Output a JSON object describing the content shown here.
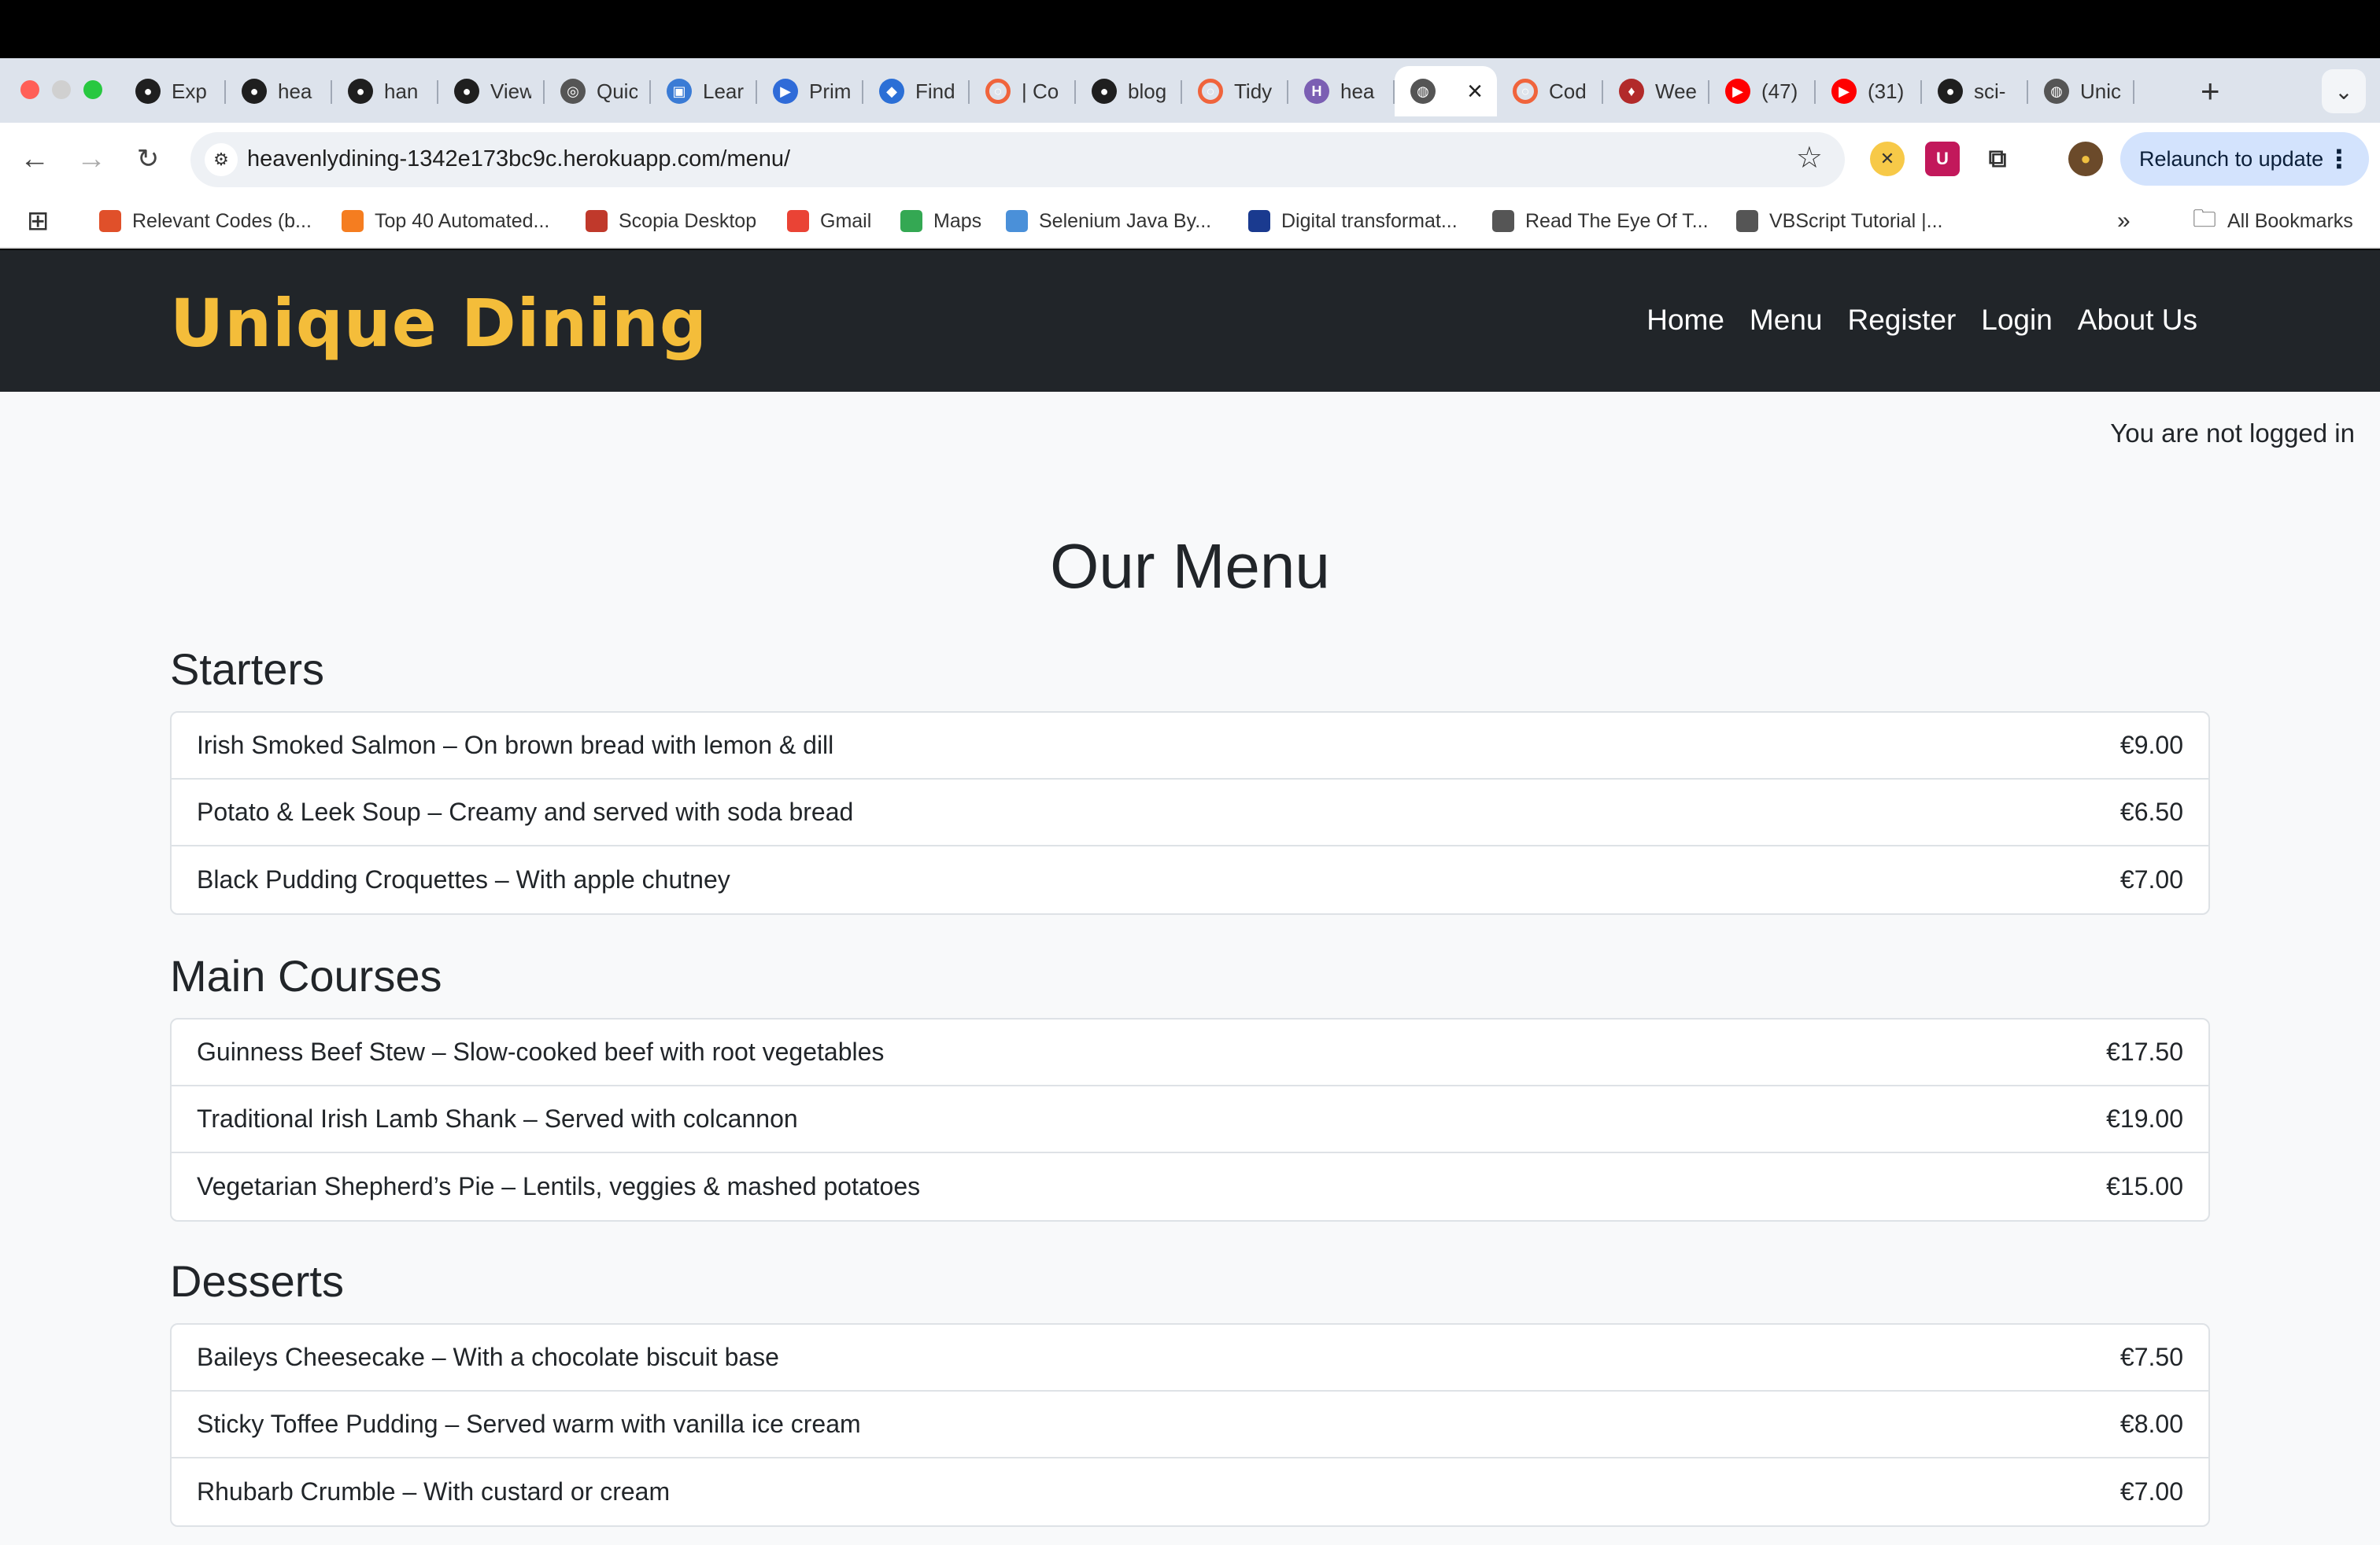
{
  "browser": {
    "tabs": [
      {
        "label": "Exp",
        "icon": "github-icon",
        "color": "#1f1f1f"
      },
      {
        "label": "hea",
        "icon": "github-icon",
        "color": "#1f1f1f"
      },
      {
        "label": "han",
        "icon": "github-icon",
        "color": "#1f1f1f"
      },
      {
        "label": "View",
        "icon": "github-icon",
        "color": "#1f1f1f"
      },
      {
        "label": "Quic",
        "icon": "quick-icon",
        "color": "#555555"
      },
      {
        "label": "Lear",
        "icon": "learn-icon",
        "color": "#3a7bd5"
      },
      {
        "label": "Prim",
        "icon": "play-icon",
        "color": "#2f6bd8"
      },
      {
        "label": "Find",
        "icon": "find-icon",
        "color": "#2b6fd6"
      },
      {
        "label": "| Co",
        "icon": "ring-icon",
        "color": "#f0643c"
      },
      {
        "label": "blog",
        "icon": "github-icon",
        "color": "#1f1f1f"
      },
      {
        "label": "Tidy",
        "icon": "ring-icon",
        "color": "#f0643c"
      },
      {
        "label": "hea",
        "icon": "heroku-icon",
        "color": "#7b5fb3"
      },
      {
        "label": "",
        "icon": "globe-icon",
        "color": "#555555",
        "active": true
      },
      {
        "label": "Cod",
        "icon": "ring-icon",
        "color": "#f0643c"
      },
      {
        "label": "Wee",
        "icon": "shield-icon",
        "color": "#b22a2a"
      },
      {
        "label": "(47)",
        "icon": "youtube-icon",
        "color": "#ff0000"
      },
      {
        "label": "(31)",
        "icon": "youtube-icon",
        "color": "#ff0000"
      },
      {
        "label": "sci-",
        "icon": "github-icon",
        "color": "#1f1f1f"
      },
      {
        "label": "Unic",
        "icon": "globe-icon",
        "color": "#555555"
      }
    ],
    "url": "heavenlydining-1342e173bc9c.herokuapp.com/menu/",
    "relaunch_label": "Relaunch to update",
    "bookmarks": [
      {
        "label": "Relevant Codes (b...",
        "color": "#e0502a"
      },
      {
        "label": "Top 40 Automated...",
        "color": "#f57d20"
      },
      {
        "label": "Scopia Desktop",
        "color": "#c0392b"
      },
      {
        "label": "Gmail",
        "color": "#ea4335"
      },
      {
        "label": "Maps",
        "color": "#34a853"
      },
      {
        "label": "Selenium Java By...",
        "color": "#4a90d9"
      },
      {
        "label": "Digital transformat...",
        "color": "#1a3a8f"
      },
      {
        "label": "Read The Eye Of T...",
        "color": "#555555"
      },
      {
        "label": "VBScript Tutorial |...",
        "color": "#555555"
      }
    ],
    "all_bookmarks_label": "All Bookmarks"
  },
  "site": {
    "brand": "Unique Dining",
    "nav": [
      "Home",
      "Menu",
      "Register",
      "Login",
      "About Us"
    ],
    "login_status": "You are not logged in",
    "title": "Our Menu",
    "sections": [
      {
        "title": "Starters",
        "items": [
          {
            "name": "Irish Smoked Salmon – On brown bread with lemon & dill",
            "price": "€9.00"
          },
          {
            "name": "Potato & Leek Soup – Creamy and served with soda bread",
            "price": "€6.50"
          },
          {
            "name": "Black Pudding Croquettes – With apple chutney",
            "price": "€7.00"
          }
        ]
      },
      {
        "title": "Main Courses",
        "items": [
          {
            "name": "Guinness Beef Stew – Slow-cooked beef with root vegetables",
            "price": "€17.50"
          },
          {
            "name": "Traditional Irish Lamb Shank – Served with colcannon",
            "price": "€19.00"
          },
          {
            "name": "Vegetarian Shepherd’s Pie – Lentils, veggies & mashed potatoes",
            "price": "€15.00"
          }
        ]
      },
      {
        "title": "Desserts",
        "items": [
          {
            "name": "Baileys Cheesecake – With a chocolate biscuit base",
            "price": "€7.50"
          },
          {
            "name": "Sticky Toffee Pudding – Served warm with vanilla ice cream",
            "price": "€8.00"
          },
          {
            "name": "Rhubarb Crumble – With custard or cream",
            "price": "€7.00"
          }
        ]
      }
    ]
  }
}
